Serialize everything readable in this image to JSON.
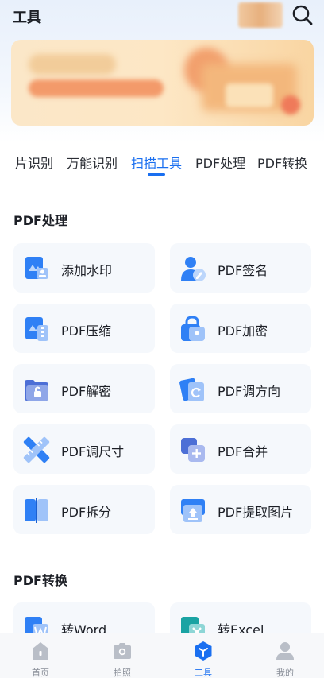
{
  "header": {
    "title": "工具"
  },
  "tabs": [
    {
      "label": "片识别"
    },
    {
      "label": "万能识别"
    },
    {
      "label": "扫描工具"
    },
    {
      "label": "PDF处理"
    },
    {
      "label": "PDF转换"
    }
  ],
  "active_tab": "扫描工具",
  "sections": [
    {
      "title": "PDF处理",
      "items": [
        {
          "label": "添加水印",
          "icon": "watermark-icon"
        },
        {
          "label": "PDF签名",
          "icon": "signature-icon"
        },
        {
          "label": "PDF压缩",
          "icon": "compress-icon"
        },
        {
          "label": "PDF加密",
          "icon": "encrypt-icon"
        },
        {
          "label": "PDF解密",
          "icon": "decrypt-icon"
        },
        {
          "label": "PDF调方向",
          "icon": "rotate-icon"
        },
        {
          "label": "PDF调尺寸",
          "icon": "resize-icon"
        },
        {
          "label": "PDF合并",
          "icon": "merge-icon"
        },
        {
          "label": "PDF拆分",
          "icon": "split-icon"
        },
        {
          "label": "PDF提取图片",
          "icon": "extract-image-icon"
        }
      ]
    },
    {
      "title": "PDF转换",
      "items": [
        {
          "label": "转Word",
          "icon": "word-icon"
        },
        {
          "label": "转Excel",
          "icon": "excel-icon"
        }
      ]
    }
  ],
  "bottom_nav": [
    {
      "label": "首页",
      "icon": "home-icon"
    },
    {
      "label": "拍照",
      "icon": "camera-icon"
    },
    {
      "label": "工具",
      "icon": "tools-icon"
    },
    {
      "label": "我的",
      "icon": "profile-icon"
    }
  ],
  "active_nav": "工具",
  "colors": {
    "accent": "#1a6ff0",
    "card_bg": "#f5f8fc",
    "icon_blue": "#2f80f5"
  }
}
